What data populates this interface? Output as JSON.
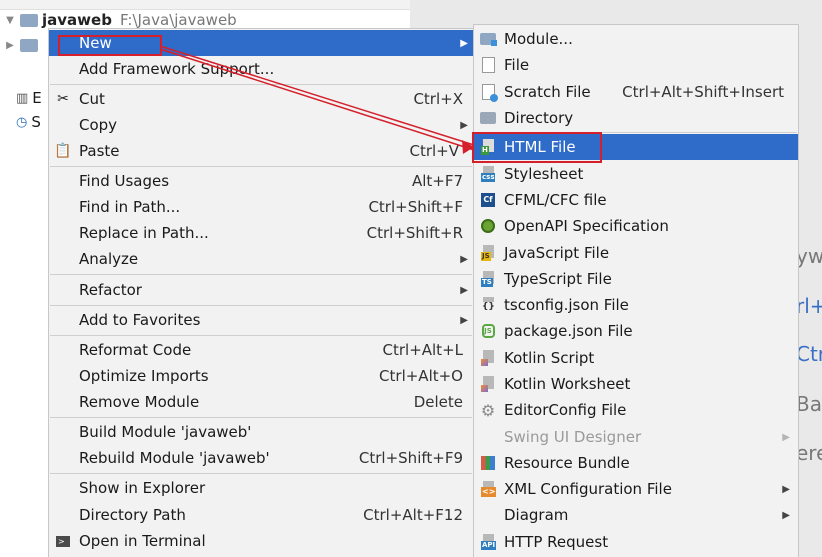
{
  "project": {
    "name": "javaweb",
    "path": "F:\\Java\\javaweb",
    "side_labels": [
      "E",
      "S"
    ]
  },
  "background_fragments": [
    "ywl",
    "rl+",
    "Ctr",
    "Ban",
    "ere"
  ],
  "context_menu": [
    {
      "label": "New",
      "shortcut": "",
      "submenu": true,
      "selected": true
    },
    {
      "label": "Add Framework Support...",
      "shortcut": ""
    },
    {
      "label": "Cut",
      "shortcut": "Ctrl+X",
      "icon": "scissors-icon"
    },
    {
      "label": "Copy",
      "shortcut": ""
    },
    {
      "label": "Paste",
      "shortcut": "Ctrl+V",
      "icon": "clipboard-icon"
    },
    {
      "label": "Find Usages",
      "shortcut": "Alt+F7"
    },
    {
      "label": "Find in Path...",
      "shortcut": "Ctrl+Shift+F"
    },
    {
      "label": "Replace in Path...",
      "shortcut": "Ctrl+Shift+R"
    },
    {
      "label": "Analyze",
      "shortcut": "",
      "submenu": true
    },
    {
      "label": "Refactor",
      "shortcut": "",
      "submenu": true
    },
    {
      "label": "Add to Favorites",
      "shortcut": "",
      "submenu": true
    },
    {
      "label": "Reformat Code",
      "shortcut": "Ctrl+Alt+L"
    },
    {
      "label": "Optimize Imports",
      "shortcut": "Ctrl+Alt+O"
    },
    {
      "label": "Remove Module",
      "shortcut": "Delete"
    },
    {
      "label": "Build Module 'javaweb'",
      "shortcut": ""
    },
    {
      "label": "Rebuild Module 'javaweb'",
      "shortcut": "Ctrl+Shift+F9"
    },
    {
      "label": "Show in Explorer",
      "shortcut": ""
    },
    {
      "label": "Directory Path",
      "shortcut": "Ctrl+Alt+F12"
    },
    {
      "label": "Open in Terminal",
      "shortcut": "",
      "icon": "terminal-icon"
    }
  ],
  "new_submenu": [
    {
      "label": "Module...",
      "shortcut": "",
      "icon": "module-folder-icon"
    },
    {
      "label": "File",
      "shortcut": "",
      "icon": "file-icon"
    },
    {
      "label": "Scratch File",
      "shortcut": "Ctrl+Alt+Shift+Insert",
      "icon": "scratch-file-icon"
    },
    {
      "label": "Directory",
      "shortcut": "",
      "icon": "folder-icon"
    },
    {
      "label": "HTML File",
      "shortcut": "",
      "icon": "html-file-icon",
      "selected": true
    },
    {
      "label": "Stylesheet",
      "shortcut": "",
      "icon": "css-file-icon"
    },
    {
      "label": "CFML/CFC file",
      "shortcut": "",
      "icon": "cfml-file-icon"
    },
    {
      "label": "OpenAPI Specification",
      "shortcut": "",
      "icon": "openapi-icon"
    },
    {
      "label": "JavaScript File",
      "shortcut": "",
      "icon": "javascript-file-icon"
    },
    {
      "label": "TypeScript File",
      "shortcut": "",
      "icon": "typescript-file-icon"
    },
    {
      "label": "tsconfig.json File",
      "shortcut": "",
      "icon": "tsconfig-file-icon"
    },
    {
      "label": "package.json File",
      "shortcut": "",
      "icon": "nodejs-icon"
    },
    {
      "label": "Kotlin Script",
      "shortcut": "",
      "icon": "kotlin-script-icon"
    },
    {
      "label": "Kotlin Worksheet",
      "shortcut": "",
      "icon": "kotlin-worksheet-icon"
    },
    {
      "label": "EditorConfig File",
      "shortcut": "",
      "icon": "gear-icon"
    },
    {
      "label": "Swing UI Designer",
      "shortcut": "",
      "submenu": true,
      "disabled": true
    },
    {
      "label": "Resource Bundle",
      "shortcut": "",
      "icon": "resource-bundle-icon"
    },
    {
      "label": "XML Configuration File",
      "shortcut": "",
      "submenu": true,
      "icon": "xml-file-icon"
    },
    {
      "label": "Diagram",
      "shortcut": "",
      "submenu": true
    },
    {
      "label": "HTTP Request",
      "shortcut": "",
      "icon": "api-file-icon"
    }
  ],
  "colors": {
    "selection": "#2f6cc9",
    "menu_bg": "#f2f2f2",
    "annotation_red": "#d51f2b"
  }
}
